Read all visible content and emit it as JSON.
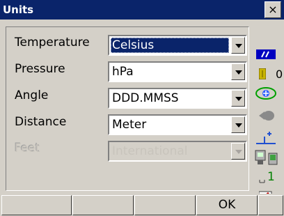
{
  "window": {
    "title": "Units",
    "close_glyph": "×"
  },
  "settings": [
    {
      "label": "Temperature",
      "value": "Celsius",
      "selected": true,
      "disabled": false
    },
    {
      "label": "Pressure",
      "value": "hPa",
      "selected": false,
      "disabled": false
    },
    {
      "label": "Angle",
      "value": "DDD.MMSS",
      "selected": false,
      "disabled": false
    },
    {
      "label": "Distance",
      "value": "Meter",
      "selected": false,
      "disabled": false
    },
    {
      "label": "Feet",
      "value": "International",
      "selected": false,
      "disabled": true
    }
  ],
  "status_bar": {
    "battery_digit": "0",
    "icons": [
      "signal-bars-icon",
      "battery-icon",
      "prism-target-icon",
      "compensator-icon",
      "ems-measure-icon",
      "instrument-connection-icon",
      "input-mode-icon",
      "pencil-icon"
    ],
    "input_mode_digit": "1"
  },
  "softkeys": [
    "",
    "",
    "",
    "OK",
    ""
  ],
  "colors": {
    "title_bg": "#0a246a",
    "selection_bg": "#0a246a",
    "face": "#d4d0c8"
  }
}
